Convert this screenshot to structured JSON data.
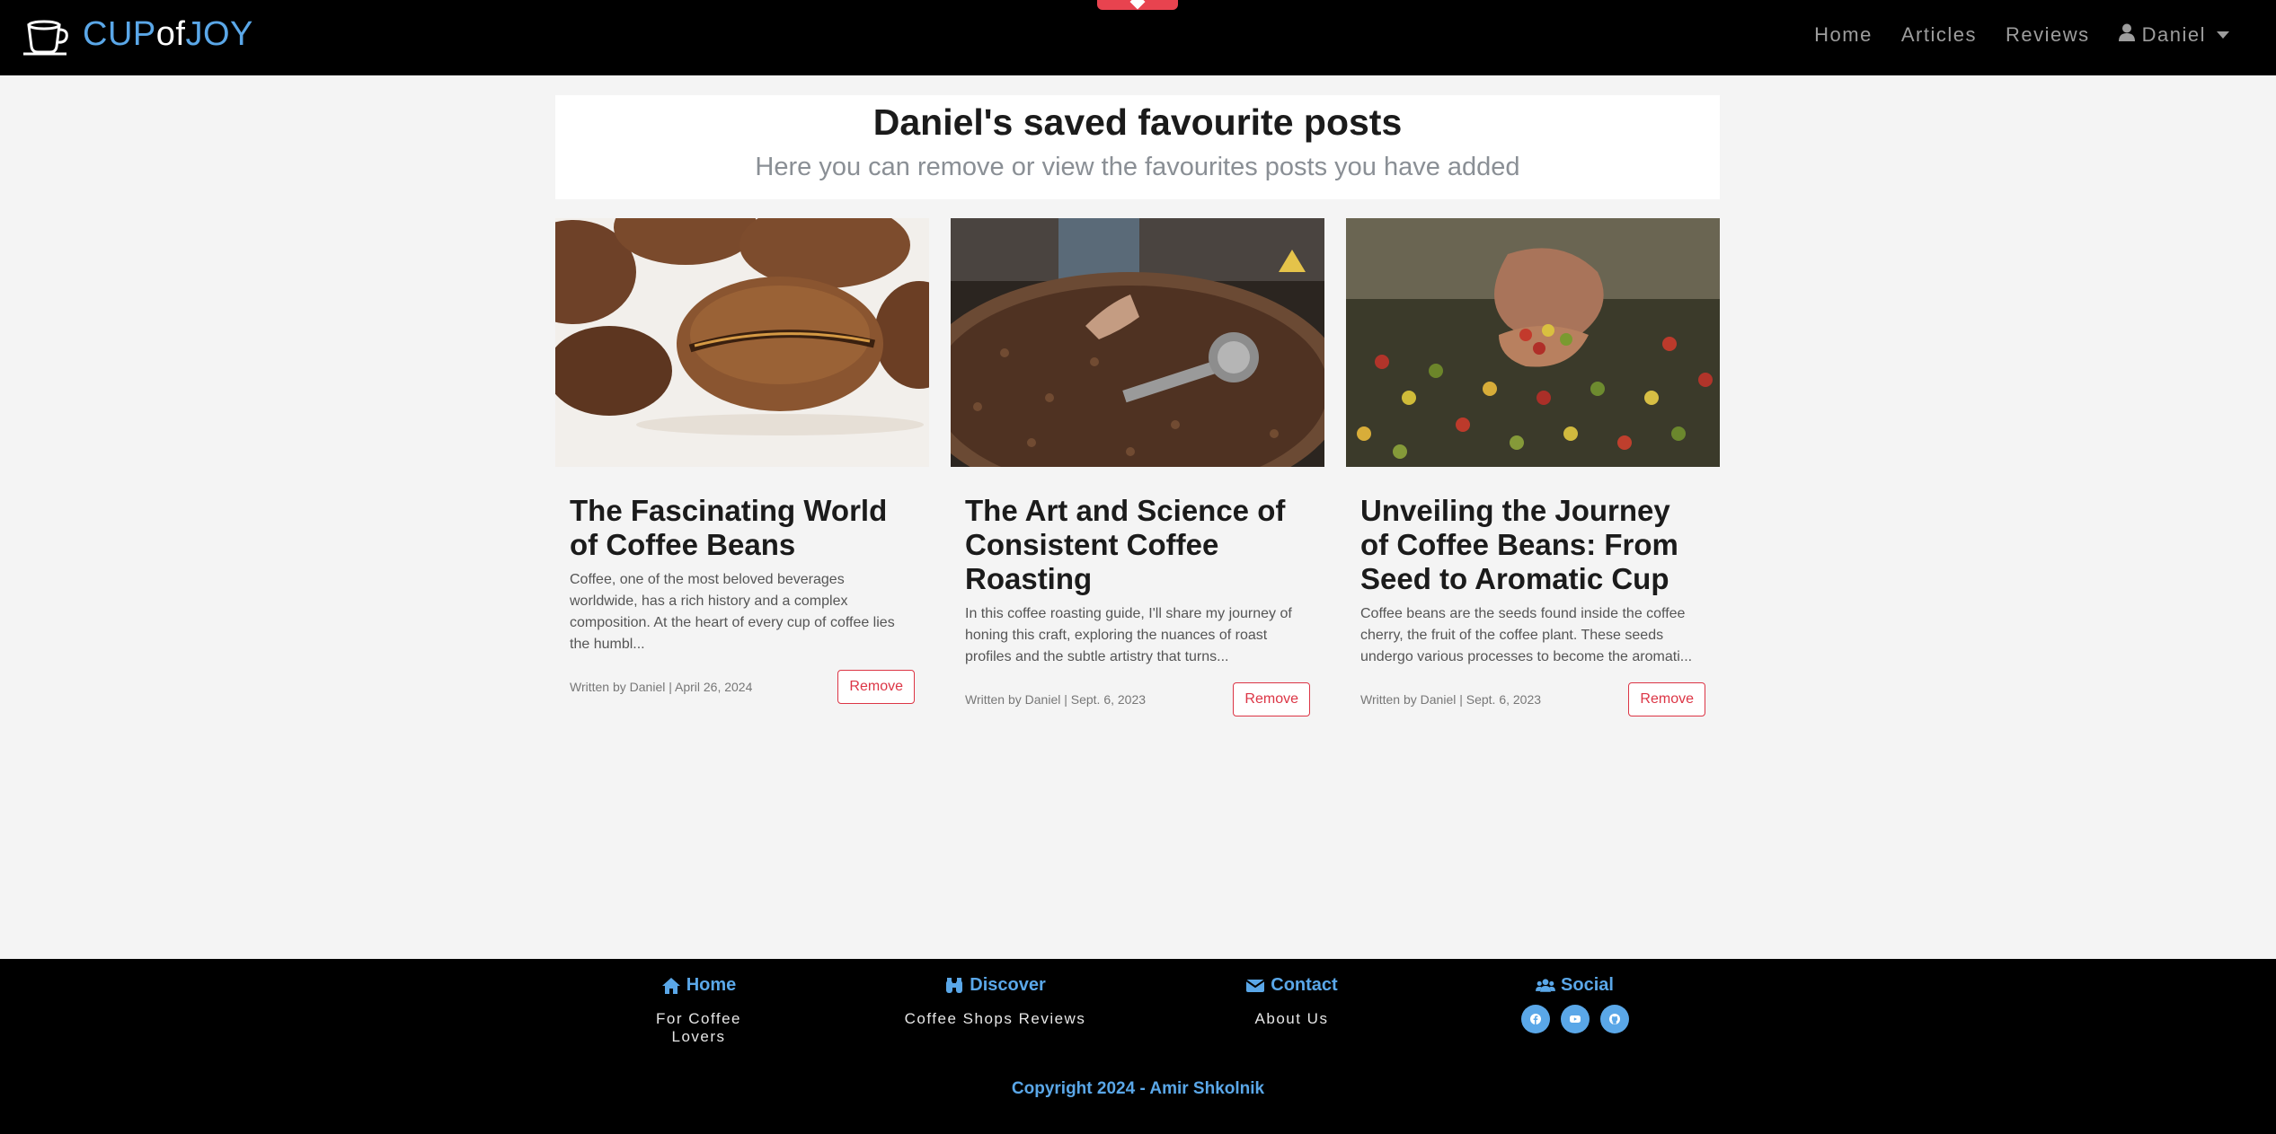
{
  "brand": {
    "cup": "CUP",
    "of": "of",
    "joy": "JOY",
    "icon": "coffee-cup-icon"
  },
  "nav": {
    "home": "Home",
    "articles": "Articles",
    "reviews": "Reviews",
    "user": "Daniel",
    "user_icon": "user-icon"
  },
  "header": {
    "title": "Daniel's saved favourite posts",
    "subtitle": "Here you can remove or view the favourites posts you have added"
  },
  "cards": [
    {
      "title": "The Fascinating World of Coffee Beans",
      "excerpt": "Coffee, one of the most beloved beverages worldwide, has a rich history and a complex composition. At the heart of every cup of coffee lies the humbl...",
      "meta": "Written by Daniel | April 26, 2024",
      "button": "Remove"
    },
    {
      "title": "The Art and Science of Consistent Coffee Roasting",
      "excerpt": "In this coffee roasting guide, I'll share my journey of honing this craft, exploring the nuances of roast profiles and the subtle artistry that turns...",
      "meta": "Written by Daniel | Sept. 6, 2023",
      "button": "Remove"
    },
    {
      "title": "Unveiling the Journey of Coffee Beans: From Seed to Aromatic Cup",
      "excerpt": "Coffee beans are the seeds found inside the coffee cherry, the fruit of the coffee plant. These seeds undergo various processes to become the aromati...",
      "meta": "Written by Daniel | Sept. 6, 2023",
      "button": "Remove"
    }
  ],
  "footer": {
    "home": {
      "heading": "Home",
      "link": "For Coffee Lovers",
      "icon": "home-icon"
    },
    "discover": {
      "heading": "Discover",
      "link": "Coffee Shops Reviews",
      "icon": "binoculars-icon"
    },
    "contact": {
      "heading": "Contact",
      "link": "About Us",
      "icon": "envelope-icon"
    },
    "social": {
      "heading": "Social",
      "icon": "users-icon",
      "links": [
        "facebook-icon",
        "youtube-icon",
        "github-icon"
      ]
    },
    "copyright": "Copyright 2024 - Amir Shkolnik"
  },
  "colors": {
    "accent": "#5aa7e8",
    "danger": "#dc3545",
    "navbar": "#000000",
    "page_bg": "#f4f4f4"
  }
}
